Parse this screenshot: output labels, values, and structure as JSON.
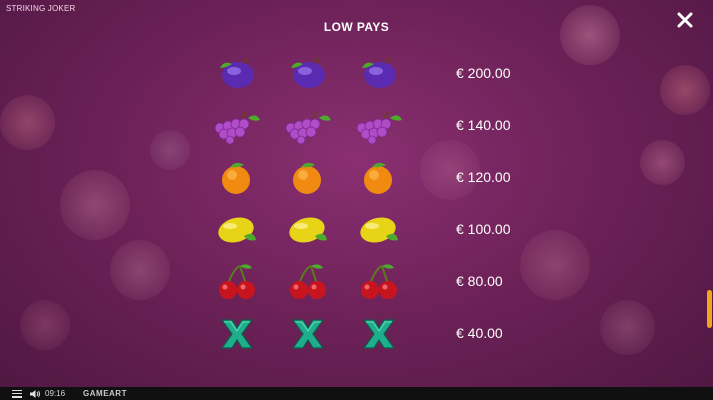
{
  "game": {
    "title": "STRIKING JOKER"
  },
  "paytable": {
    "title": "LOW PAYS",
    "rows": [
      {
        "symbol": "plum-icon",
        "payout": "€ 200.00"
      },
      {
        "symbol": "grapes-icon",
        "payout": "€ 140.00"
      },
      {
        "symbol": "orange-icon",
        "payout": "€ 120.00"
      },
      {
        "symbol": "lemon-icon",
        "payout": "€ 100.00"
      },
      {
        "symbol": "cherries-icon",
        "payout": "€ 80.00"
      },
      {
        "symbol": "x-icon",
        "payout": "€ 40.00"
      }
    ]
  },
  "close": {
    "icon": "close-icon"
  },
  "status_bar": {
    "time": "09:16",
    "brand": "GAMEART",
    "menu_icon": "menu-icon",
    "sound_icon": "speaker-icon"
  },
  "colors": {
    "background": "#6e2258",
    "accent": "#f3a41d",
    "text": "#ffffff"
  }
}
